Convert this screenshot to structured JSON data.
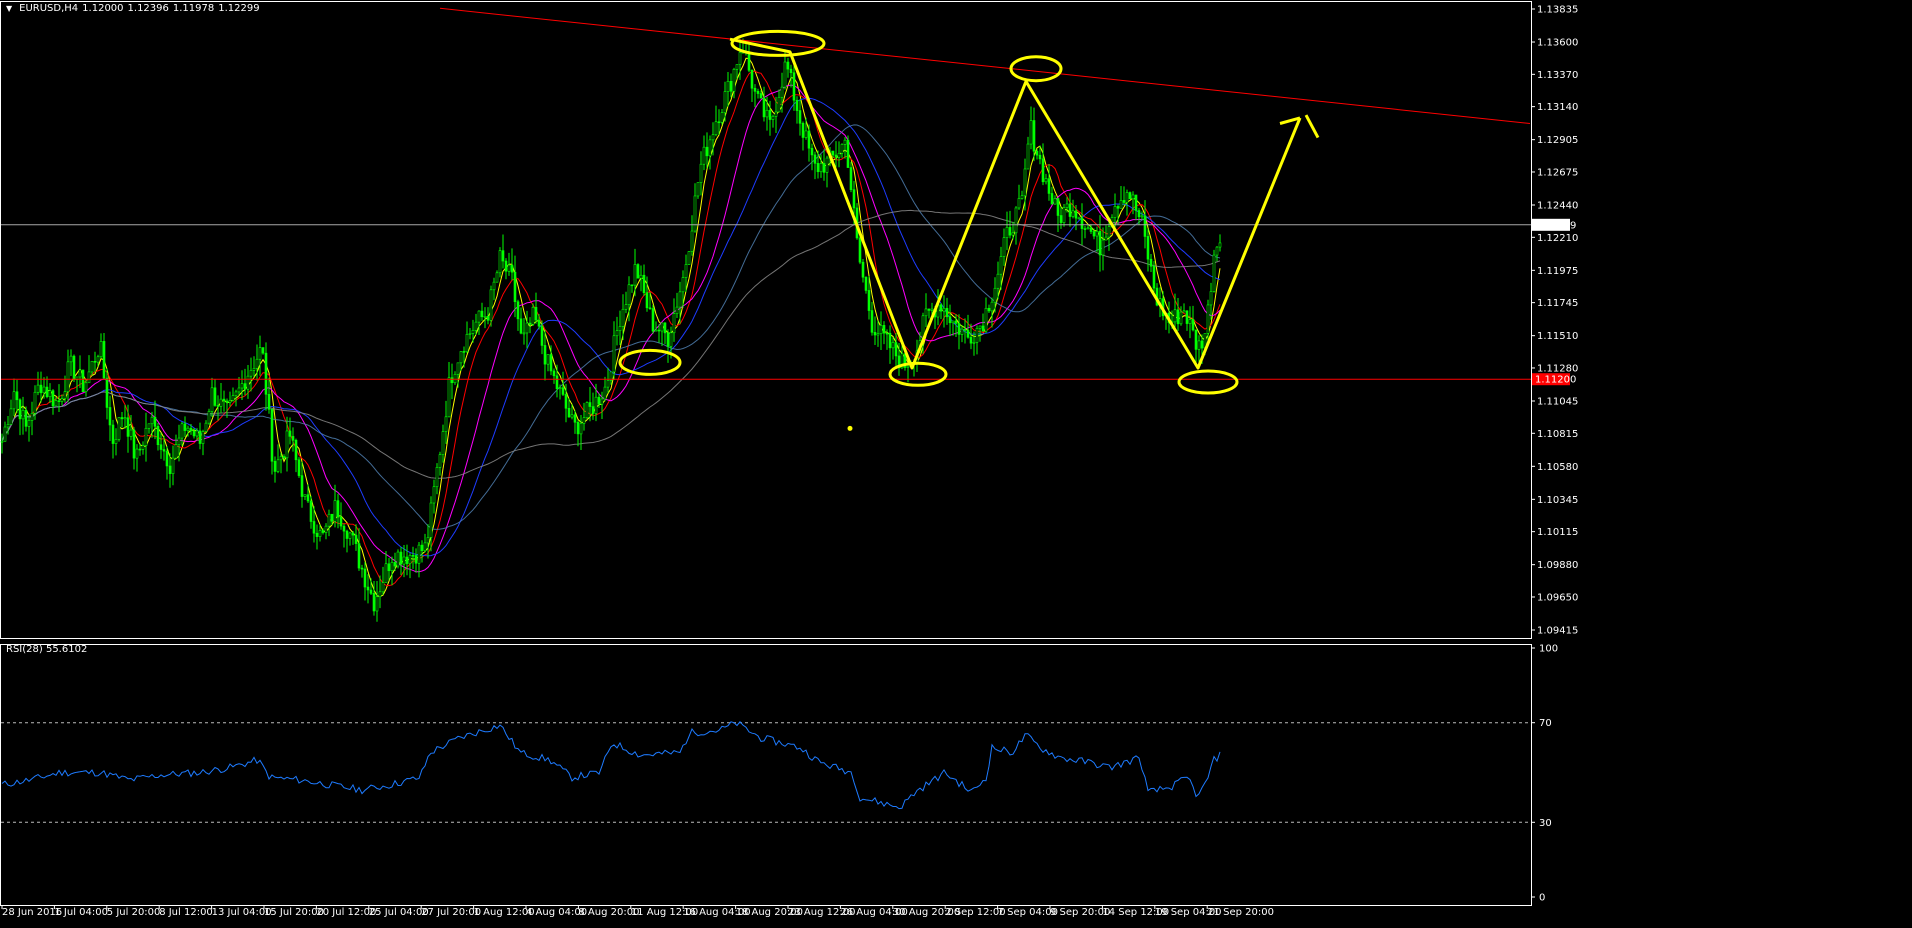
{
  "header": {
    "symbol_timeframe": "EURUSD,H4",
    "ohlc": [
      "1.12000",
      "1.12396",
      "1.11978",
      "1.12299"
    ]
  },
  "rsi_header": {
    "label": "RSI(28) 55.6102"
  },
  "colors": {
    "background": "#000000",
    "frame": "#ffffff",
    "candle": "#00ff00",
    "trendline": "#ff0000",
    "annotation": "#ffff00",
    "rsi_line": "#1e7bff",
    "ma_yellow": "#ffff00",
    "ma_red": "#ff0000",
    "ma_magenta": "#ff00ff",
    "ma_blue": "#1e3cff",
    "ma_steelblue": "#4f7fb0",
    "ma_gray": "#8a8a8a",
    "level_line": "#a8a8a8"
  },
  "chart_data": [
    {
      "type": "candlestick",
      "symbol": "EURUSD",
      "timeframe": "H4",
      "ylim": [
        1.09415,
        1.13835
      ],
      "y_ticks": [
        "1.13835",
        "1.13600",
        "1.13370",
        "1.13140",
        "1.12905",
        "1.12675",
        "1.12440",
        "1.12210",
        "1.11975",
        "1.11745",
        "1.11510",
        "1.11280",
        "1.11045",
        "1.10815",
        "1.10580",
        "1.10345",
        "1.10115",
        "1.09880",
        "1.09650",
        "1.09415"
      ],
      "x_ticks": [
        "28 Jun 2016",
        "1 Jul 04:00",
        "5 Jul 20:00",
        "8 Jul 12:00",
        "13 Jul 04:00",
        "15 Jul 20:00",
        "20 Jul 12:00",
        "25 Jul 04:00",
        "27 Jul 20:00",
        "1 Aug 12:00",
        "4 Aug 04:00",
        "8 Aug 20:00",
        "11 Aug 12:00",
        "16 Aug 04:00",
        "18 Aug 20:00",
        "23 Aug 12:00",
        "26 Aug 04:00",
        "30 Aug 20:00",
        "2 Sep 12:00",
        "7 Sep 04:00",
        "9 Sep 20:00",
        "14 Sep 12:00",
        "19 Sep 04:00",
        "21 Sep 20:00"
      ],
      "close_path": [
        [
          0,
          1.107
        ],
        [
          14,
          1.1112
        ],
        [
          26,
          1.1085
        ],
        [
          40,
          1.1118
        ],
        [
          58,
          1.1102
        ],
        [
          70,
          1.113
        ],
        [
          84,
          1.1115
        ],
        [
          100,
          1.1145
        ],
        [
          112,
          1.1075
        ],
        [
          124,
          1.1098
        ],
        [
          136,
          1.1062
        ],
        [
          150,
          1.1092
        ],
        [
          170,
          1.106
        ],
        [
          186,
          1.1088
        ],
        [
          200,
          1.1075
        ],
        [
          212,
          1.111
        ],
        [
          228,
          1.1095
        ],
        [
          248,
          1.1125
        ],
        [
          262,
          1.1142
        ],
        [
          274,
          1.1055
        ],
        [
          290,
          1.108
        ],
        [
          306,
          1.103
        ],
        [
          322,
          1.1006
        ],
        [
          336,
          1.103
        ],
        [
          350,
          1.101
        ],
        [
          362,
          1.0985
        ],
        [
          374,
          1.0962
        ],
        [
          392,
          1.0995
        ],
        [
          410,
          1.0995
        ],
        [
          426,
          1.1
        ],
        [
          438,
          1.106
        ],
        [
          450,
          1.112
        ],
        [
          462,
          1.1145
        ],
        [
          476,
          1.116
        ],
        [
          488,
          1.1168
        ],
        [
          500,
          1.1205
        ],
        [
          512,
          1.119
        ],
        [
          522,
          1.1145
        ],
        [
          534,
          1.1165
        ],
        [
          548,
          1.113
        ],
        [
          560,
          1.111
        ],
        [
          574,
          1.1085
        ],
        [
          590,
          1.1098
        ],
        [
          606,
          1.1115
        ],
        [
          620,
          1.1165
        ],
        [
          636,
          1.12
        ],
        [
          652,
          1.116
        ],
        [
          668,
          1.115
        ],
        [
          684,
          1.1195
        ],
        [
          700,
          1.127
        ],
        [
          716,
          1.1305
        ],
        [
          730,
          1.133
        ],
        [
          742,
          1.136
        ],
        [
          756,
          1.132
        ],
        [
          770,
          1.13
        ],
        [
          786,
          1.1345
        ],
        [
          800,
          1.1305
        ],
        [
          814,
          1.127
        ],
        [
          830,
          1.1275
        ],
        [
          846,
          1.129
        ],
        [
          858,
          1.121
        ],
        [
          872,
          1.116
        ],
        [
          888,
          1.1145
        ],
        [
          904,
          1.113
        ],
        [
          916,
          1.114
        ],
        [
          926,
          1.1165
        ],
        [
          940,
          1.1175
        ],
        [
          954,
          1.116
        ],
        [
          968,
          1.115
        ],
        [
          982,
          1.116
        ],
        [
          996,
          1.119
        ],
        [
          1008,
          1.1225
        ],
        [
          1022,
          1.1245
        ],
        [
          1030,
          1.13
        ],
        [
          1044,
          1.1265
        ],
        [
          1058,
          1.1235
        ],
        [
          1072,
          1.1245
        ],
        [
          1086,
          1.123
        ],
        [
          1100,
          1.1215
        ],
        [
          1114,
          1.1245
        ],
        [
          1128,
          1.1255
        ],
        [
          1142,
          1.123
        ],
        [
          1156,
          1.1178
        ],
        [
          1170,
          1.116
        ],
        [
          1184,
          1.117
        ],
        [
          1198,
          1.1142
        ],
        [
          1206,
          1.1155
        ],
        [
          1214,
          1.121
        ],
        [
          1222,
          1.123
        ]
      ],
      "current_price": 1.12299,
      "current_price_label": "1.12299",
      "support_level": 1.112,
      "support_label": "1.11200",
      "resistance_trendline": [
        [
          440,
          1.1384
        ],
        [
          1530,
          1.1302
        ]
      ],
      "ma_periods": [
        5,
        10,
        21,
        34,
        55,
        100
      ],
      "pattern_zigzag": [
        [
          730,
          1.1362
        ],
        [
          790,
          1.1353
        ],
        [
          912,
          1.1128
        ],
        [
          1026,
          1.1332
        ],
        [
          1198,
          1.1128
        ],
        [
          1300,
          1.1306
        ]
      ],
      "arrowhead_wings": [
        [
          [
            1280,
            1.1302
          ],
          [
            1300,
            1.1306
          ]
        ],
        [
          [
            1306,
            1.1308
          ],
          [
            1318,
            1.1292
          ]
        ]
      ],
      "highlight_ellipses": [
        [
          778,
          1.1359
        ],
        [
          1036,
          1.1341
        ],
        [
          650,
          1.1132
        ],
        [
          918,
          1.11235
        ],
        [
          1208,
          1.1118
        ]
      ],
      "highlight_dot": [
        850,
        1.1085
      ]
    },
    {
      "type": "line",
      "indicator": "RSI",
      "period": 28,
      "value": 55.6102,
      "ylim": [
        0,
        100
      ],
      "y_ticks": [
        "100",
        "70",
        "30",
        "0"
      ],
      "levels": [
        70,
        30
      ],
      "path": [
        [
          0,
          45
        ],
        [
          30,
          47
        ],
        [
          60,
          50
        ],
        [
          100,
          50
        ],
        [
          130,
          47
        ],
        [
          160,
          49
        ],
        [
          200,
          50
        ],
        [
          230,
          52
        ],
        [
          258,
          55
        ],
        [
          270,
          48
        ],
        [
          300,
          47
        ],
        [
          330,
          45
        ],
        [
          362,
          43
        ],
        [
          390,
          45
        ],
        [
          420,
          48
        ],
        [
          430,
          58
        ],
        [
          460,
          64
        ],
        [
          500,
          69
        ],
        [
          520,
          58
        ],
        [
          550,
          55
        ],
        [
          572,
          48
        ],
        [
          600,
          50
        ],
        [
          612,
          62
        ],
        [
          640,
          57
        ],
        [
          680,
          58
        ],
        [
          690,
          66
        ],
        [
          720,
          67
        ],
        [
          736,
          70
        ],
        [
          760,
          64
        ],
        [
          800,
          60
        ],
        [
          820,
          54
        ],
        [
          852,
          50
        ],
        [
          860,
          40
        ],
        [
          880,
          38
        ],
        [
          900,
          36
        ],
        [
          915,
          42
        ],
        [
          930,
          46
        ],
        [
          945,
          50
        ],
        [
          972,
          42
        ],
        [
          986,
          48
        ],
        [
          992,
          60
        ],
        [
          1012,
          58
        ],
        [
          1026,
          65
        ],
        [
          1040,
          60
        ],
        [
          1060,
          56
        ],
        [
          1090,
          54
        ],
        [
          1110,
          52
        ],
        [
          1140,
          56
        ],
        [
          1148,
          42
        ],
        [
          1170,
          44
        ],
        [
          1188,
          48
        ],
        [
          1198,
          40
        ],
        [
          1206,
          46
        ],
        [
          1214,
          55
        ],
        [
          1220,
          57
        ]
      ]
    }
  ]
}
